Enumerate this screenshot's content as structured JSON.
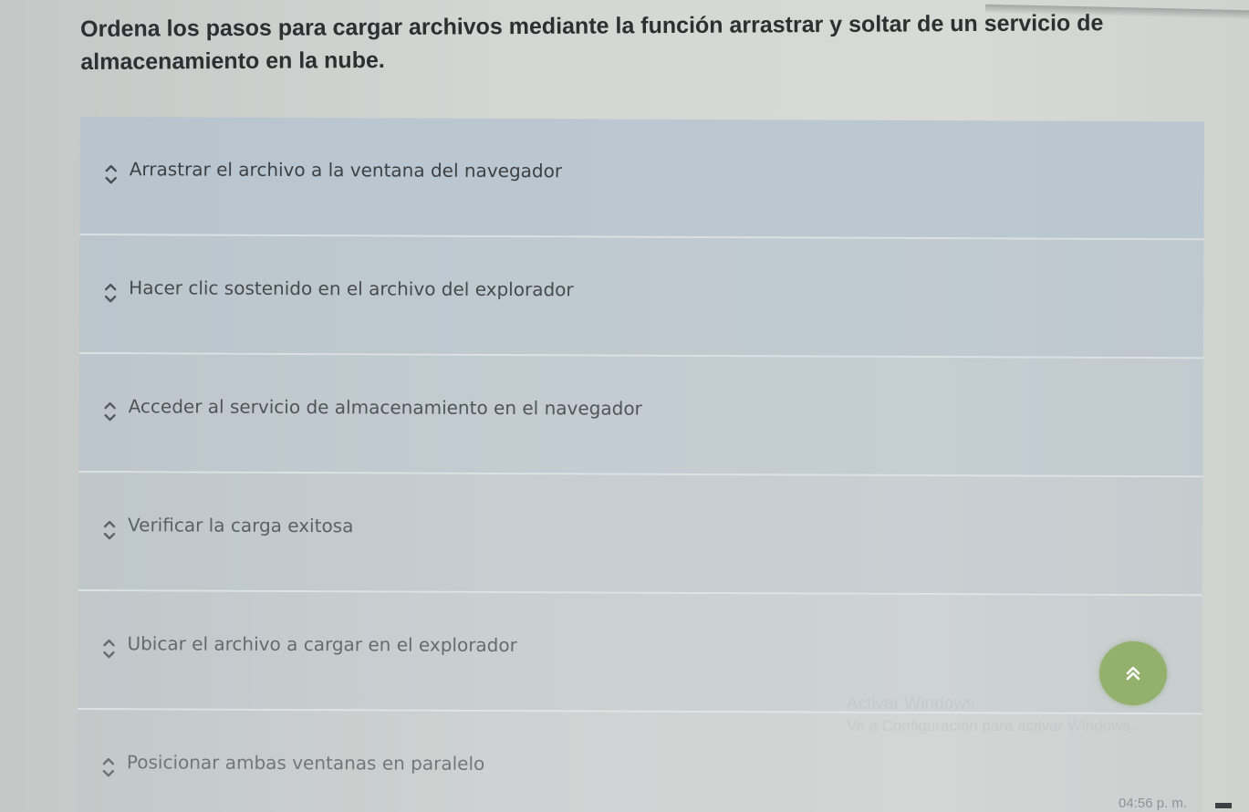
{
  "question": "Ordena los pasos para cargar archivos mediante la función arrastrar y soltar de un servicio de almacenamiento en la nube.",
  "items": [
    {
      "label": "Arrastrar el archivo a la ventana del navegador"
    },
    {
      "label": "Hacer clic sostenido en el archivo del explorador"
    },
    {
      "label": "Acceder al servicio de almacenamiento en el navegador"
    },
    {
      "label": "Verificar la carga exitosa"
    },
    {
      "label": "Ubicar el archivo a cargar en el explorador"
    },
    {
      "label": "Posicionar ambas ventanas en paralelo"
    }
  ],
  "watermark": {
    "line1": "Activar Windows",
    "line2": "Ve a Configuración para activar Windows."
  },
  "taskbar": {
    "time": "04:56 p. m."
  },
  "colors": {
    "item_background": "#bfcbd3",
    "item_text": "#3d4144",
    "arrow": "#4a4e52",
    "scroll_button": "#93b06d"
  },
  "icons": {
    "move_up": "chevron-up-icon",
    "move_down": "chevron-down-icon",
    "scroll_top": "double-chevron-up-icon"
  }
}
